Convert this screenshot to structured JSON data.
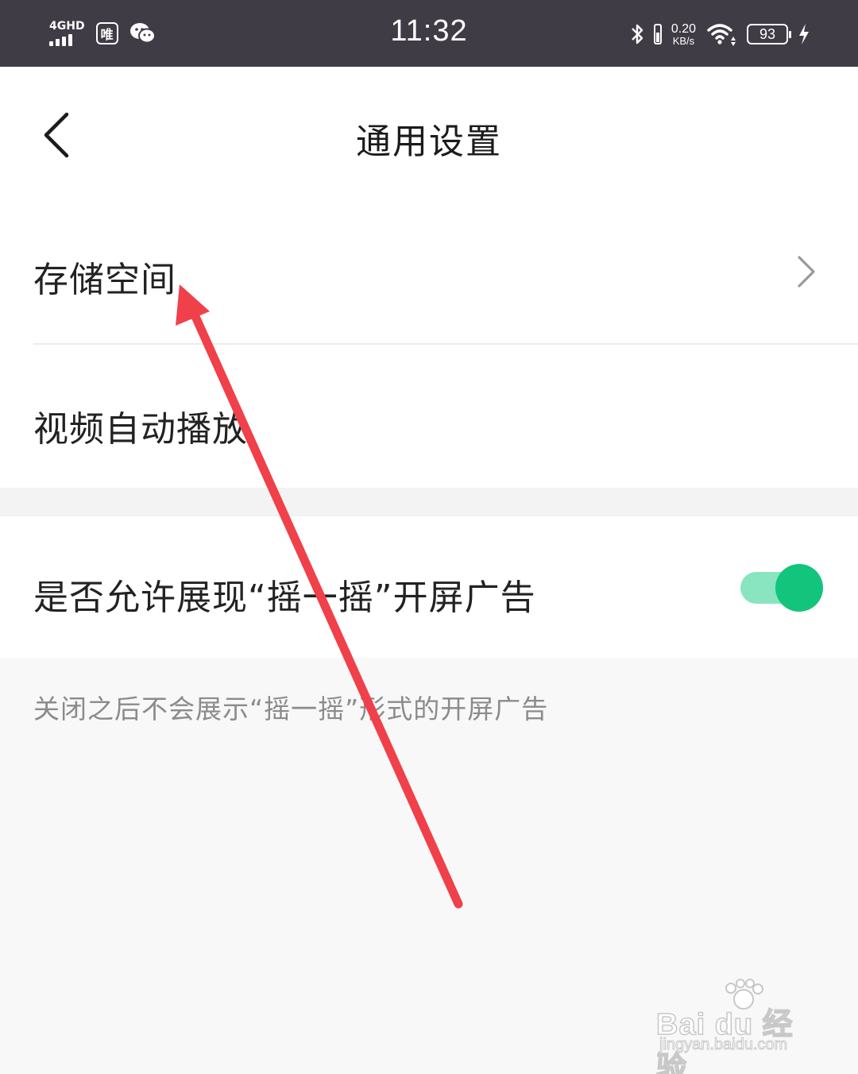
{
  "status_bar": {
    "network": "4GHD",
    "app_icon_text": "唯",
    "time": "11:32",
    "speed_value": "0.20",
    "speed_unit": "KB/s",
    "battery": "93",
    "icons": [
      "signal-icon",
      "vip-app-icon",
      "wechat-icon",
      "bluetooth-icon",
      "vibrate-icon",
      "wifi-icon",
      "battery-icon",
      "charging-icon"
    ]
  },
  "header": {
    "title": "通用设置",
    "back_icon": "back-arrow-icon"
  },
  "settings": {
    "storage_label": "存储空间",
    "autoplay_label": "视频自动播放",
    "shake_ad_label": "是否允许展现“摇一摇”开屏广告",
    "shake_ad_enabled": true,
    "shake_ad_hint": "关闭之后不会展示“摇一摇”形式的开屏广告"
  },
  "colors": {
    "status_bar": "#403c46",
    "toggle_on": "#12c47c",
    "toggle_track": "#89e4c0",
    "annotation_arrow": "#f0404a"
  },
  "watermark": {
    "brand": "Bai du 经验",
    "url": "jingyan.baidu.com"
  }
}
